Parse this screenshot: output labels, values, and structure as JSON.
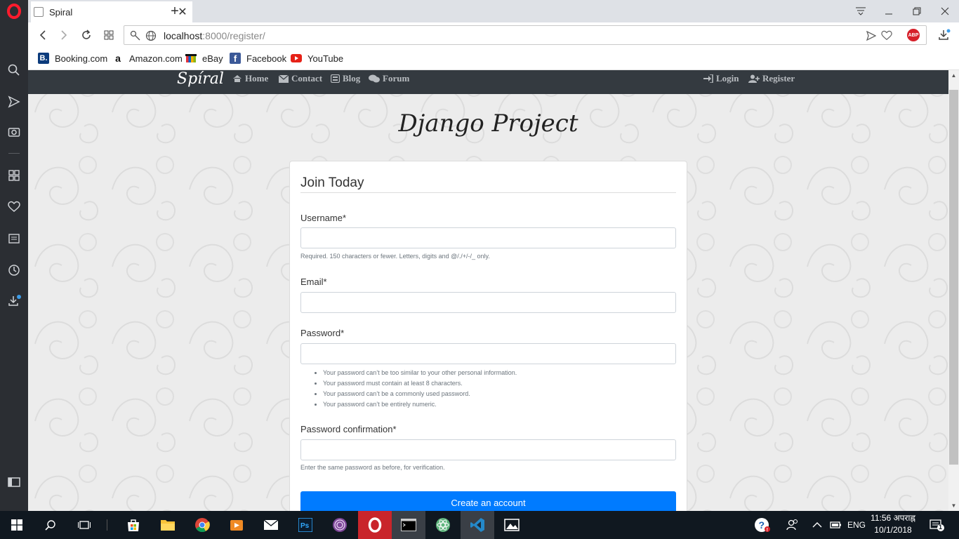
{
  "browser": {
    "tab_title": "Spiral",
    "url_host": "localhost",
    "url_path": ":8000/register/",
    "bookmarks": [
      {
        "label": "Booking.com",
        "icon": "B."
      },
      {
        "label": "Amazon.com",
        "icon": "a"
      },
      {
        "label": "eBay",
        "icon": "ebay"
      },
      {
        "label": "Facebook",
        "icon": "f"
      },
      {
        "label": "YouTube",
        "icon": "youtube"
      }
    ],
    "adblock_label": "ABP"
  },
  "site": {
    "brand": "Spíral",
    "nav": {
      "home": "Home",
      "contact": "Contact",
      "blog": "Blog",
      "forum": "Forum",
      "login": "Login",
      "register": "Register"
    },
    "hero_title": "Django Project"
  },
  "form": {
    "legend": "Join Today",
    "username_label": "Username",
    "username_help": "Required. 150 characters or fewer. Letters, digits and @/./+/-/_ only.",
    "email_label": "Email",
    "password_label": "Password",
    "password_help": [
      "Your password can’t be too similar to your other personal information.",
      "Your password must contain at least 8 characters.",
      "Your password can’t be a commonly used password.",
      "Your password can’t be entirely numeric."
    ],
    "password2_label": "Password confirmation",
    "password2_help": "Enter the same password as before, for verification.",
    "required_mark": "*",
    "submit_label": "Create an account"
  },
  "taskbar": {
    "language": "ENG",
    "time": "11:56 अपराह्न",
    "date": "10/1/2018",
    "notification_count": "1"
  },
  "colors": {
    "accent": "#007bff",
    "navbar": "#343a40",
    "opera_red": "#c9252b"
  }
}
